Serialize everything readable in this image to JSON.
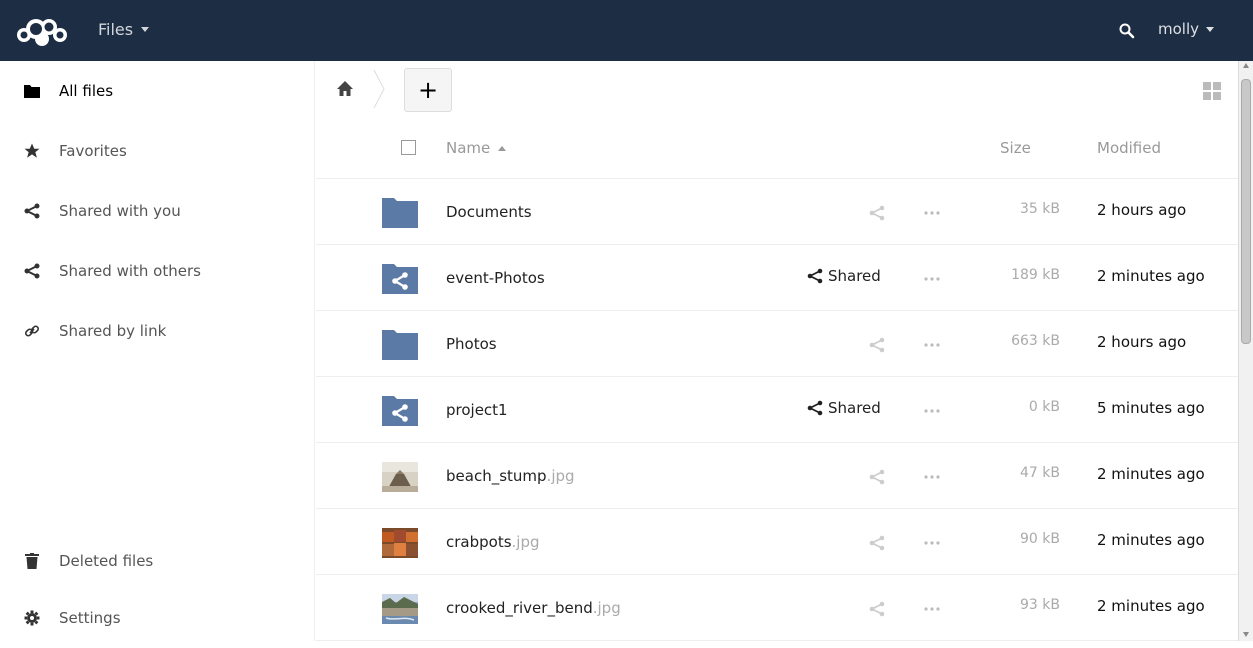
{
  "header": {
    "app_name": "Files",
    "user_name": "molly",
    "bg_color": "#1d2d44"
  },
  "sidebar": {
    "items": [
      {
        "label": "All files",
        "icon": "folder-icon",
        "active": true
      },
      {
        "label": "Favorites",
        "icon": "star-icon"
      },
      {
        "label": "Shared with you",
        "icon": "share-icon"
      },
      {
        "label": "Shared with others",
        "icon": "share-icon"
      },
      {
        "label": "Shared by link",
        "icon": "link-icon"
      }
    ],
    "bottom": [
      {
        "label": "Deleted files",
        "icon": "trash-icon"
      },
      {
        "label": "Settings",
        "icon": "gear-icon"
      }
    ]
  },
  "toolbar": {
    "new_label": "+"
  },
  "table": {
    "columns": {
      "name": "Name",
      "size": "Size",
      "modified": "Modified"
    },
    "rows": [
      {
        "name": "Documents",
        "ext": "",
        "type": "folder",
        "shared": false,
        "size": "35 kB",
        "modified": "2 hours ago"
      },
      {
        "name": "event-Photos",
        "ext": "",
        "type": "shared-folder",
        "shared": true,
        "size": "189 kB",
        "modified": "2 minutes ago"
      },
      {
        "name": "Photos",
        "ext": "",
        "type": "folder",
        "shared": false,
        "size": "663 kB",
        "modified": "2 hours ago"
      },
      {
        "name": "project1",
        "ext": "",
        "type": "shared-folder",
        "shared": true,
        "size": "0 kB",
        "modified": "5 minutes ago"
      },
      {
        "name": "beach_stump",
        "ext": ".jpg",
        "type": "image",
        "shared": false,
        "size": "47 kB",
        "modified": "2 minutes ago"
      },
      {
        "name": "crabpots",
        "ext": ".jpg",
        "type": "image",
        "shared": false,
        "size": "90 kB",
        "modified": "2 minutes ago"
      },
      {
        "name": "crooked_river_bend",
        "ext": ".jpg",
        "type": "image",
        "shared": false,
        "size": "93 kB",
        "modified": "2 minutes ago"
      }
    ],
    "shared_label": "Shared"
  },
  "colors": {
    "folder": "#5b7aa6",
    "header": "#1d2d44"
  }
}
